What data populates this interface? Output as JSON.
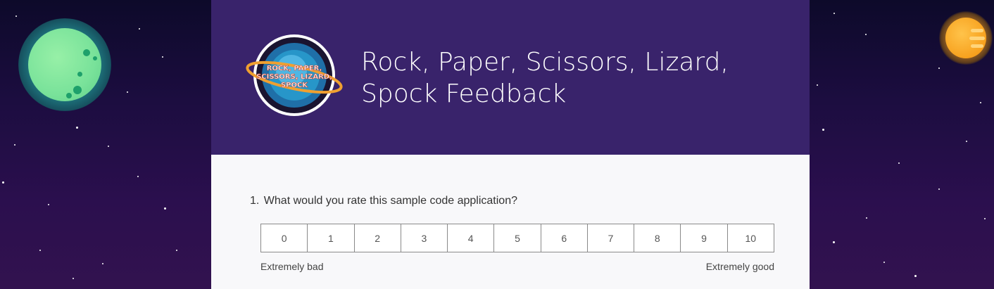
{
  "form": {
    "title": "Rock, Paper, Scissors, Lizard, Spock Feedback",
    "logo_text": "ROCK, PAPER, SCISSORS, LIZARD, SPOCK",
    "question": {
      "number": "1.",
      "text": "What would you rate this sample code application?",
      "scale_options": [
        "0",
        "1",
        "2",
        "3",
        "4",
        "5",
        "6",
        "7",
        "8",
        "9",
        "10"
      ],
      "low_label": "Extremely bad",
      "high_label": "Extremely good"
    }
  },
  "colors": {
    "header": "#39236b",
    "body": "#f8f8fa",
    "space_background": "#1c0d40",
    "planet_left": "#79e29a",
    "planet_right": "#f7a11e"
  }
}
